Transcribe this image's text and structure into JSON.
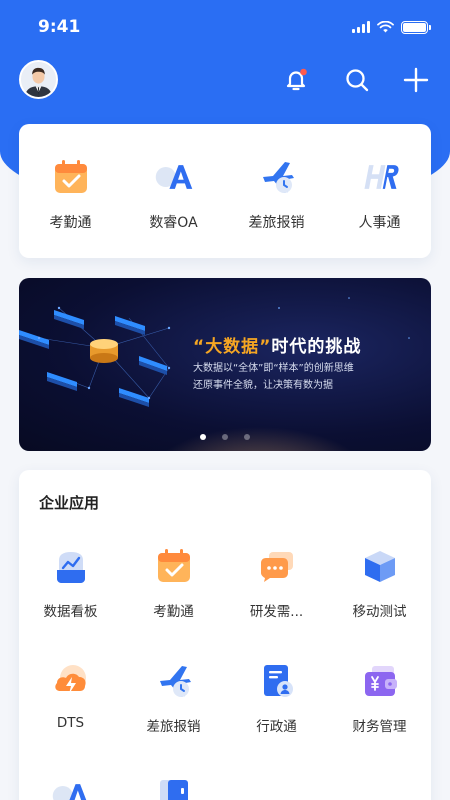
{
  "status_bar": {
    "time": "9:41"
  },
  "header": {
    "avatar_icon": "user-avatar",
    "actions": [
      "bell-icon",
      "search-icon",
      "plus-icon"
    ],
    "notification_dot_color": "#ff5a4e"
  },
  "quick_access": [
    {
      "label": "考勤通",
      "icon": "calendar-check-icon"
    },
    {
      "label": "数睿OA",
      "icon": "oa-logo-icon"
    },
    {
      "label": "差旅报销",
      "icon": "airplane-clock-icon"
    },
    {
      "label": "人事通",
      "icon": "hr-logo-icon"
    }
  ],
  "banner": {
    "title_quote_open": "“",
    "title_highlight": "大数据",
    "title_quote_close": "”",
    "title_rest": "时代的挑战",
    "line1": "大数据以“全体”即“样本”的创新思维",
    "line2": "还原事件全貌，让决策有数为据",
    "active_slide": 1,
    "slide_count": 3
  },
  "enterprise_apps": {
    "title": "企业应用",
    "items": [
      {
        "label": "数据看板",
        "icon": "chart-bag-icon"
      },
      {
        "label": "考勤通",
        "icon": "calendar-check-icon"
      },
      {
        "label": "研发需...",
        "icon": "chat-bubbles-icon"
      },
      {
        "label": "移动测试",
        "icon": "cube-icon"
      },
      {
        "label": "DTS",
        "icon": "cloud-bolt-icon"
      },
      {
        "label": "差旅报销",
        "icon": "airplane-clock-icon"
      },
      {
        "label": "行政通",
        "icon": "document-user-icon"
      },
      {
        "label": "财务管理",
        "icon": "wallet-yen-icon"
      }
    ]
  },
  "colors": {
    "primary": "#2a6ef3",
    "accent_orange": "#f5a623"
  }
}
